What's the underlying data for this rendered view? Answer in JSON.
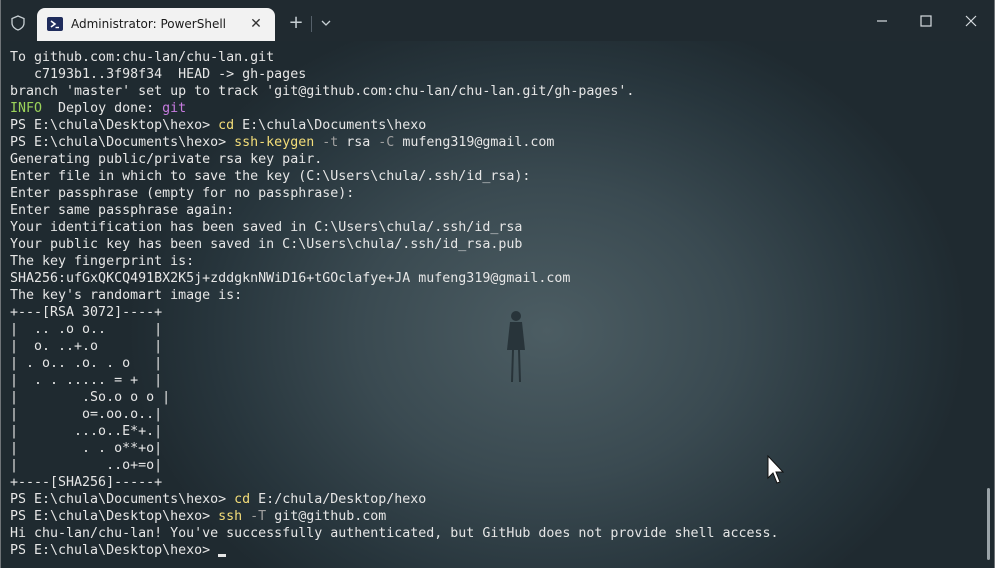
{
  "window": {
    "tab_title": "Administrator: PowerShell",
    "icons": {
      "shield": "shield-icon",
      "tab": "powershell-icon",
      "close_tab": "close-icon",
      "new_tab": "plus-icon",
      "dropdown": "chevron-down-icon",
      "minimize": "minimize-icon",
      "maximize": "maximize-icon",
      "close": "close-icon"
    },
    "new_tab_glyph": "+",
    "close_glyph": "✕"
  },
  "terminal": {
    "lines": [
      "To github.com:chu-lan/chu-lan.git",
      "   c7193b1..3f98f34  HEAD -> gh-pages",
      "branch 'master' set up to track 'git@github.com:chu-lan/chu-lan.git/gh-pages'.",
      {
        "info": "INFO",
        "rest": "  Deploy done: ",
        "git": "git"
      },
      {
        "prompt": "PS E:\\chula\\Desktop\\hexo> ",
        "cmd": "cd",
        "args": " E:\\chula\\Documents\\hexo"
      },
      {
        "prompt": "PS E:\\chula\\Documents\\hexo> ",
        "cmd": "ssh-keygen",
        "flag1": " -t",
        "arg1": " rsa",
        "flag2": " -C",
        "arg2": " mufeng319@gmail.com"
      },
      "Generating public/private rsa key pair.",
      "Enter file in which to save the key (C:\\Users\\chula/.ssh/id_rsa):",
      "Enter passphrase (empty for no passphrase):",
      "Enter same passphrase again:",
      "Your identification has been saved in C:\\Users\\chula/.ssh/id_rsa",
      "Your public key has been saved in C:\\Users\\chula/.ssh/id_rsa.pub",
      "The key fingerprint is:",
      "SHA256:ufGxQKCQ491BX2K5j+zddgknNWiD16+tGOclafye+JA mufeng319@gmail.com",
      "The key's randomart image is:",
      "+---[RSA 3072]----+",
      "|  .. .o o..      |",
      "|  o. ..+.o       |",
      "| . o.. .o. . o   |",
      "|  . . ..... = +  |",
      "|        .So.o o o |",
      "|        o=.oo.o..|",
      "|       ...o..E*+.|",
      "|        . . o**+o|",
      "|           ..o+=o|",
      "+----[SHA256]-----+",
      {
        "prompt": "PS E:\\chula\\Documents\\hexo> ",
        "cmd": "cd",
        "args": " E:/chula/Desktop/hexo"
      },
      {
        "prompt": "PS E:\\chula\\Desktop\\hexo> ",
        "cmd": "ssh",
        "flag1": " -T",
        "arg1": " git@github.com"
      },
      "Hi chu-lan/chu-lan! You've successfully authenticated, but GitHub does not provide shell access.",
      {
        "prompt": "PS E:\\chula\\Desktop\\hexo> ",
        "cursor": true
      }
    ]
  },
  "colors": {
    "command": "#f3dd79",
    "flag": "#a0a0a0",
    "info": "#9bd35a",
    "git": "#c77be0",
    "text": "#e6e6e6"
  }
}
